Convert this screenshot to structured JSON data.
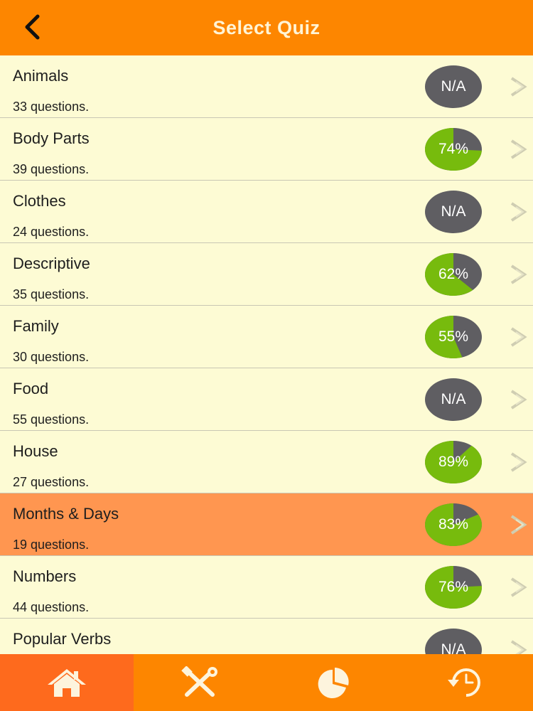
{
  "header": {
    "title": "Select Quiz"
  },
  "quizzes": [
    {
      "name": "Animals",
      "count": "33 questions.",
      "score_label": "N/A",
      "score_fraction": null
    },
    {
      "name": "Body Parts",
      "count": "39 questions.",
      "score_label": "74%",
      "score_fraction": 0.74
    },
    {
      "name": "Clothes",
      "count": "24 questions.",
      "score_label": "N/A",
      "score_fraction": null
    },
    {
      "name": "Descriptive",
      "count": "35 questions.",
      "score_label": "62%",
      "score_fraction": 0.62
    },
    {
      "name": "Family",
      "count": "30 questions.",
      "score_label": "55%",
      "score_fraction": 0.55
    },
    {
      "name": "Food",
      "count": "55 questions.",
      "score_label": "N/A",
      "score_fraction": null
    },
    {
      "name": "House",
      "count": "27 questions.",
      "score_label": "89%",
      "score_fraction": 0.89
    },
    {
      "name": "Months & Days",
      "count": "19 questions.",
      "score_label": "83%",
      "score_fraction": 0.83,
      "selected": true
    },
    {
      "name": "Numbers",
      "count": "44 questions.",
      "score_label": "76%",
      "score_fraction": 0.76
    },
    {
      "name": "Popular Verbs",
      "count": "",
      "score_label": "N/A",
      "score_fraction": null
    }
  ],
  "colors": {
    "header": "#fd8600",
    "row_bg": "#fdfbd4",
    "row_selected": "#ff9650",
    "score_fill": "#77bb0d",
    "score_empty": "#5f5e62",
    "tab_active": "#fe6a1d",
    "icon": "#fdf4dd"
  },
  "tabs": [
    {
      "id": "home",
      "icon": "home-icon",
      "active": true
    },
    {
      "id": "tools",
      "icon": "tools-icon",
      "active": false
    },
    {
      "id": "stats",
      "icon": "pie-chart-icon",
      "active": false
    },
    {
      "id": "history",
      "icon": "history-icon",
      "active": false
    }
  ]
}
